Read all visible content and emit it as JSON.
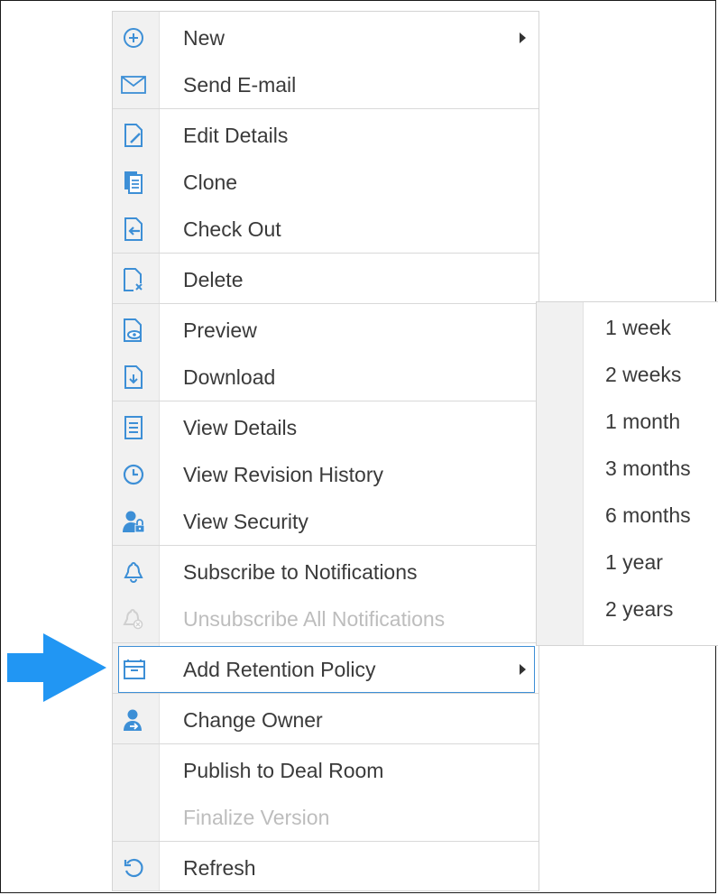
{
  "colors": {
    "accent": "#2196f3",
    "icon": "#3d8fd6",
    "disabled": "#bdbdbd",
    "text": "#3a3a3a"
  },
  "menu": {
    "items": [
      {
        "label": "New",
        "icon": "plus-circle-icon",
        "submenu": true
      },
      {
        "label": "Send E-mail",
        "icon": "envelope-icon"
      },
      {
        "label": "Edit Details",
        "icon": "edit-document-icon"
      },
      {
        "label": "Clone",
        "icon": "clone-icon"
      },
      {
        "label": "Check Out",
        "icon": "check-out-icon"
      },
      {
        "label": "Delete",
        "icon": "delete-document-icon"
      },
      {
        "label": "Preview",
        "icon": "preview-icon"
      },
      {
        "label": "Download",
        "icon": "download-icon"
      },
      {
        "label": "View Details",
        "icon": "details-icon"
      },
      {
        "label": "View Revision History",
        "icon": "clock-icon"
      },
      {
        "label": "View Security",
        "icon": "user-lock-icon"
      },
      {
        "label": "Subscribe to Notifications",
        "icon": "bell-icon"
      },
      {
        "label": "Unsubscribe All Notifications",
        "icon": "bell-off-icon",
        "disabled": true
      },
      {
        "label": "Add Retention Policy",
        "icon": "archive-box-icon",
        "submenu": true,
        "highlighted": true
      },
      {
        "label": "Change Owner",
        "icon": "user-switch-icon"
      },
      {
        "label": "Publish to Deal Room",
        "icon": ""
      },
      {
        "label": "Finalize Version",
        "icon": "",
        "disabled": true
      },
      {
        "label": "Refresh",
        "icon": "refresh-icon"
      }
    ]
  },
  "submenu": {
    "items": [
      {
        "label": "1 week"
      },
      {
        "label": "2 weeks"
      },
      {
        "label": "1 month"
      },
      {
        "label": "3 months"
      },
      {
        "label": "6 months"
      },
      {
        "label": "1 year"
      },
      {
        "label": "2 years"
      }
    ]
  }
}
